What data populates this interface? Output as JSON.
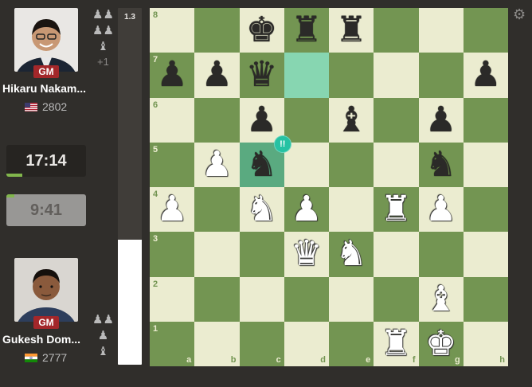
{
  "top_player": {
    "name": "Hikaru Nakam...",
    "title": "GM",
    "rating": "2802",
    "flag": "US",
    "captured_icons": [
      "♟♟",
      "♟♟",
      "♝"
    ],
    "material_advantage": "+1"
  },
  "bottom_player": {
    "name": "Gukesh Dom...",
    "title": "GM",
    "rating": "2777",
    "flag": "IN",
    "captured_icons": [
      "♟♟",
      "♟",
      "♝"
    ]
  },
  "clocks": {
    "top": "17:14",
    "bottom": "9:41",
    "top_progress": 0.2,
    "bottom_progress": 0.1
  },
  "eval_bar": {
    "value": "1.3",
    "white_fraction": 0.35
  },
  "board": {
    "files": [
      "a",
      "b",
      "c",
      "d",
      "e",
      "f",
      "g",
      "h"
    ],
    "ranks": [
      "8",
      "7",
      "6",
      "5",
      "4",
      "3",
      "2",
      "1"
    ],
    "rows": [
      [
        "",
        "",
        "bk",
        "br",
        "br",
        "",
        "",
        ""
      ],
      [
        "bp",
        "bp",
        "bq",
        "",
        "",
        "",
        "",
        "bp"
      ],
      [
        "",
        "",
        "bp",
        "",
        "bb",
        "",
        "bp",
        ""
      ],
      [
        "",
        "wp",
        "bn",
        "",
        "",
        "",
        "bn",
        ""
      ],
      [
        "wp",
        "",
        "wn",
        "wp",
        "",
        "wr",
        "wp",
        ""
      ],
      [
        "",
        "",
        "",
        "wq",
        "wn",
        "",
        "",
        ""
      ],
      [
        "",
        "",
        "",
        "",
        "",
        "",
        "wb",
        ""
      ],
      [
        "",
        "",
        "",
        "",
        "",
        "wr",
        "wk",
        ""
      ]
    ],
    "highlighted_squares": [
      "c5",
      "d7"
    ],
    "annotation_square": "c5",
    "annotation_text": "!!",
    "colors": {
      "light": "#ebecd0",
      "dark": "#739552",
      "highlight": "#5aaa80",
      "brilliant": "#26c2a3"
    }
  },
  "settings_icon": "gear-icon"
}
